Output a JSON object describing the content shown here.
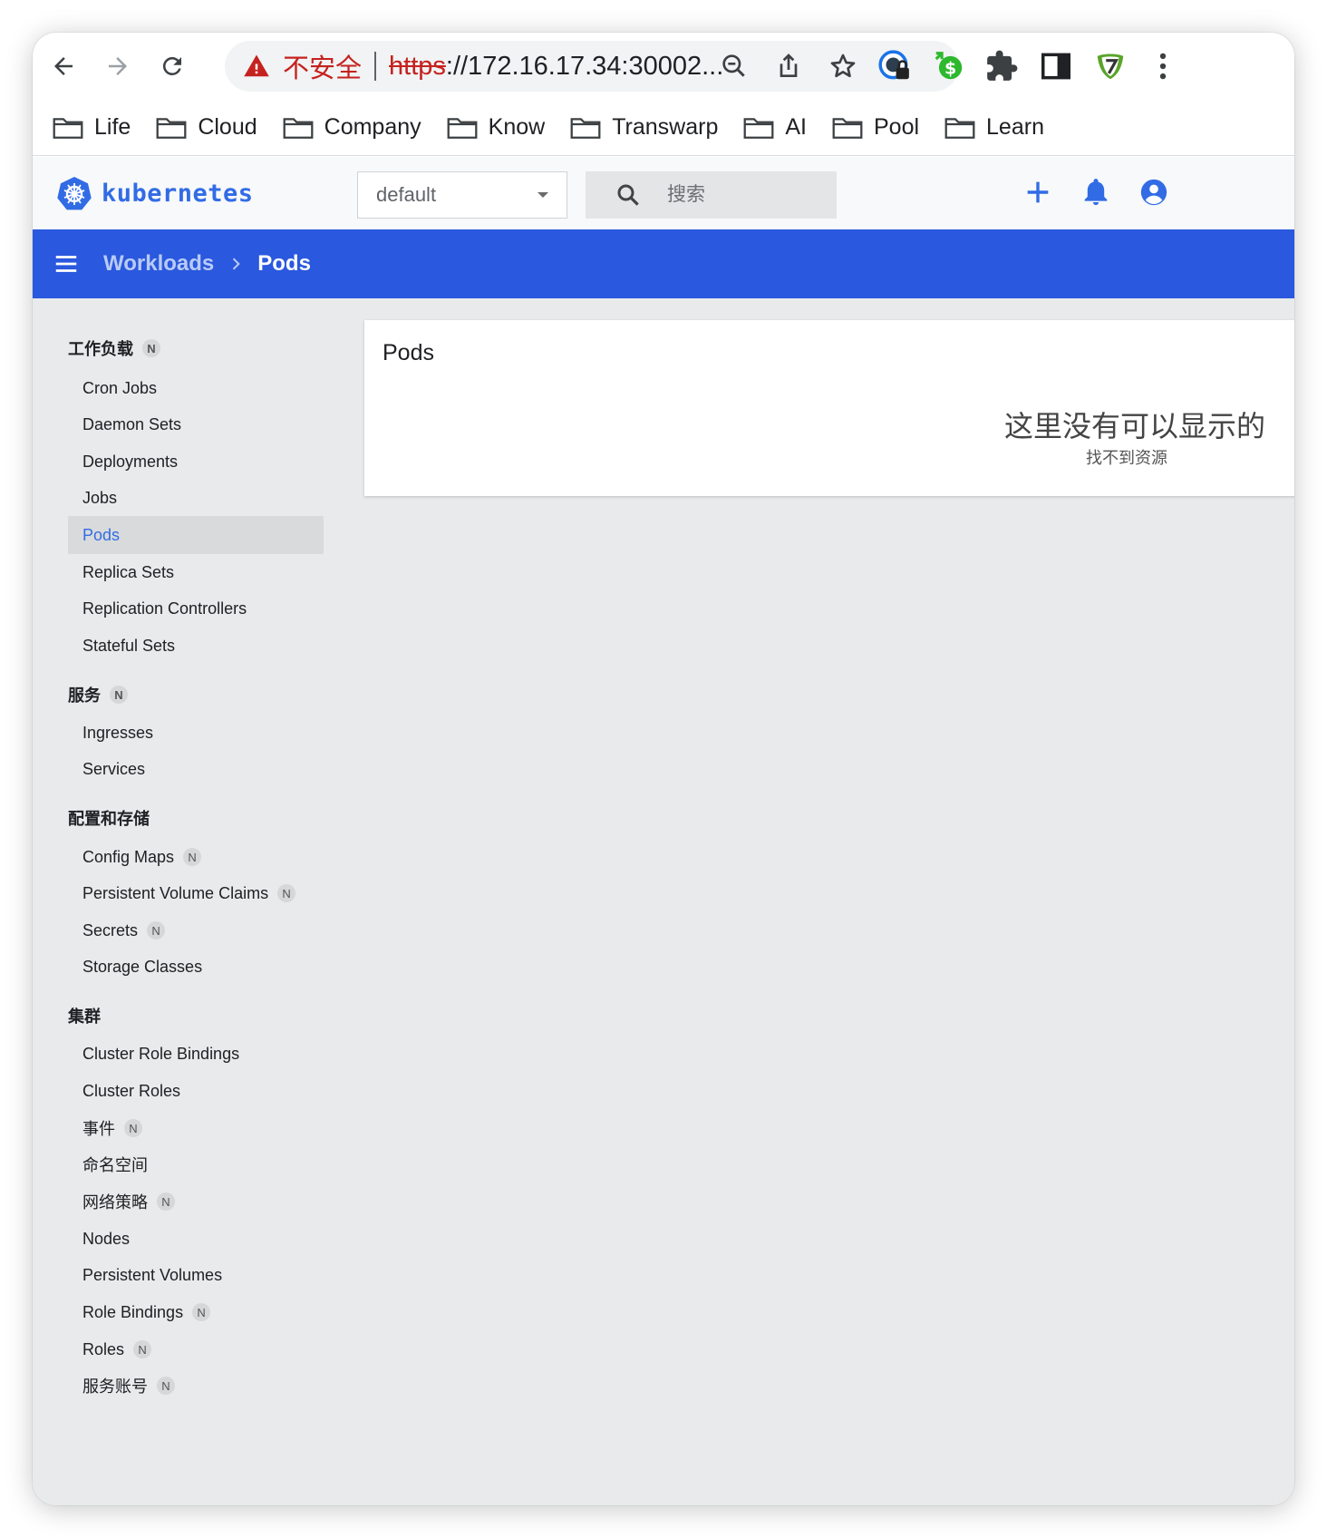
{
  "browser": {
    "insecure_label": "不安全",
    "url_scheme": "https",
    "url_rest": "://172.16.17.34:30002...",
    "bookmarks": [
      "Life",
      "Cloud",
      "Company",
      "Know",
      "Transwarp",
      "AI",
      "Pool",
      "Learn"
    ]
  },
  "app": {
    "logo_text": "kubernetes",
    "namespace": "default",
    "search_placeholder": "搜索",
    "accent_color": "#326ce5",
    "bar_color": "#2a58de"
  },
  "breadcrumb": {
    "parent": "Workloads",
    "current": "Pods"
  },
  "sidebar": {
    "badge": "N",
    "sections": [
      {
        "title": "工作负载",
        "items": [
          {
            "label": "Cron Jobs"
          },
          {
            "label": "Daemon Sets"
          },
          {
            "label": "Deployments"
          },
          {
            "label": "Jobs"
          },
          {
            "label": "Pods"
          },
          {
            "label": "Replica Sets"
          },
          {
            "label": "Replication Controllers"
          },
          {
            "label": "Stateful Sets"
          }
        ]
      },
      {
        "title": "服务",
        "items": [
          {
            "label": "Ingresses"
          },
          {
            "label": "Services"
          }
        ]
      },
      {
        "title": "配置和存储",
        "items": [
          {
            "label": "Config Maps"
          },
          {
            "label": "Persistent Volume Claims"
          },
          {
            "label": "Secrets"
          },
          {
            "label": "Storage Classes"
          }
        ]
      },
      {
        "title": "集群",
        "items": [
          {
            "label": "Cluster Role Bindings"
          },
          {
            "label": "Cluster Roles"
          },
          {
            "label": "事件"
          },
          {
            "label": "命名空间"
          },
          {
            "label": "网络策略"
          },
          {
            "label": "Nodes"
          },
          {
            "label": "Persistent Volumes"
          },
          {
            "label": "Role Bindings"
          },
          {
            "label": "Roles"
          },
          {
            "label": "服务账号"
          }
        ]
      }
    ]
  },
  "main": {
    "card_title": "Pods",
    "empty_title": "这里没有可以显示的",
    "empty_subtitle": "找不到资源"
  }
}
